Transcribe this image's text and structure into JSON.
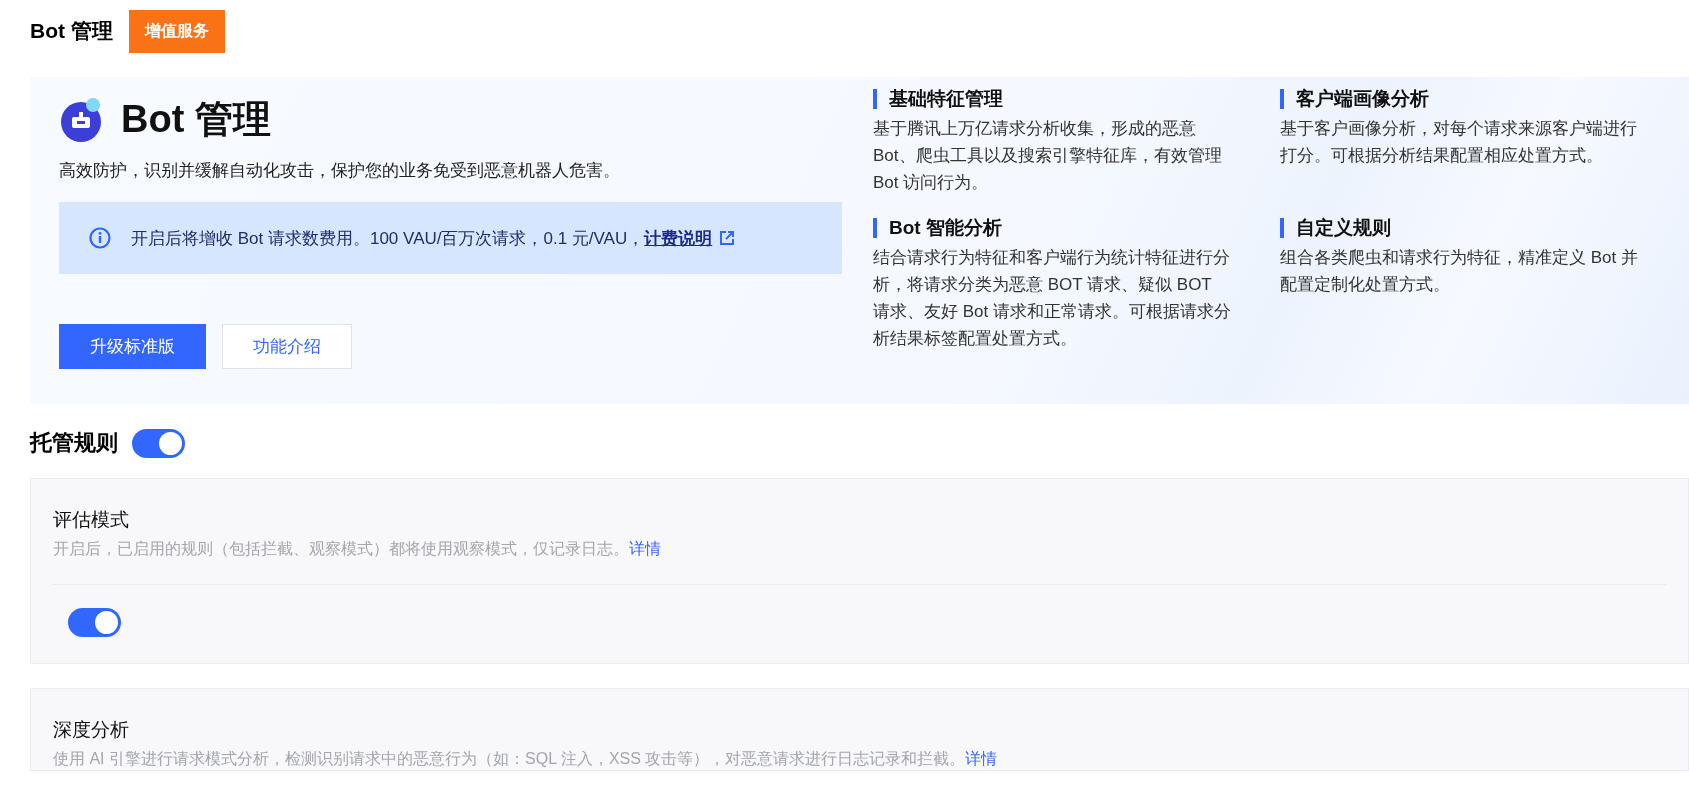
{
  "header": {
    "title": "Bot 管理",
    "badge": "增值服务"
  },
  "hero": {
    "title": "Bot 管理",
    "description": "高效防护，识别并缓解自动化攻击，保护您的业务免受到恶意机器人危害。",
    "notice": {
      "text": "开启后将增收 Bot 请求数费用。100 VAU/百万次请求，0.1 元/VAU，",
      "link": "计费说明"
    },
    "buttons": [
      {
        "label": "升级标准版",
        "kind": "primary"
      },
      {
        "label": "功能介绍",
        "kind": "secondary"
      }
    ],
    "features": [
      {
        "title": "基础特征管理",
        "text": "基于腾讯上万亿请求分析收集，形成的恶意 Bot、爬虫工具以及搜索引擎特征库，有效管理 Bot 访问行为。"
      },
      {
        "title": "客户端画像分析",
        "text": "基于客户画像分析，对每个请求来源客户端进行打分。可根据分析结果配置相应处置方式。"
      },
      {
        "title": "Bot 智能分析",
        "text": "结合请求行为特征和客户端行为统计特征进行分析，将请求分类为恶意 BOT 请求、疑似 BOT 请求、友好 Bot 请求和正常请求。可根据请求分析结果标签配置处置方式。"
      },
      {
        "title": "自定义规则",
        "text": "组合各类爬虫和请求行为特征，精准定义 Bot 并配置定制化处置方式。"
      }
    ]
  },
  "section": {
    "title": "托管规则",
    "on": true
  },
  "cards": [
    {
      "title": "评估模式",
      "description": "开启后，已启用的规则（包括拦截、观察模式）都将使用观察模式，仅记录日志。",
      "link": "详情",
      "on": true
    },
    {
      "title": "深度分析",
      "description": "使用 AI 引擎进行请求模式分析，检测识别请求中的恶意行为（如：SQL 注入，XSS 攻击等），对恶意请求进行日志记录和拦截。",
      "link": "详情"
    }
  ]
}
